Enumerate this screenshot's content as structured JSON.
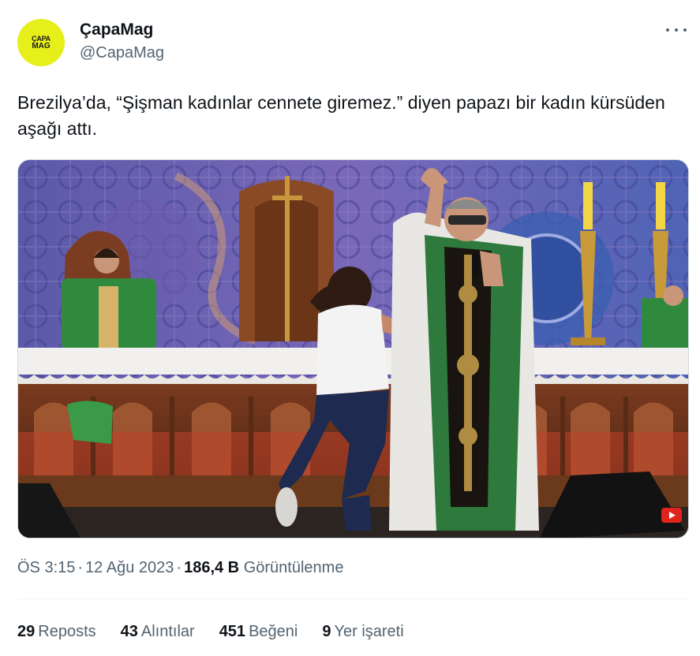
{
  "author": {
    "name": "ÇapaMag",
    "handle": "@CapaMag",
    "avatar_text_top": "ÇAPA",
    "avatar_text_bottom": "MAG",
    "avatar_color": "#e6ef1a"
  },
  "tweet": {
    "text": "Brezilya’da, “Şişman kadınlar cennete giremez.” diyen papazı bir kadın kürsüden aşağı attı."
  },
  "meta": {
    "time": "ÖS 3:15",
    "date": "12 Ağu 2023",
    "views_count": "186,4 B",
    "views_label": "Görüntülenme"
  },
  "stats": [
    {
      "count": "29",
      "label": "Reposts"
    },
    {
      "count": "43",
      "label": "Alıntılar"
    },
    {
      "count": "451",
      "label": "Beğeni"
    },
    {
      "count": "9",
      "label": "Yer işareti"
    }
  ],
  "icons": {
    "more": "more-horizontal-icon",
    "media_badge": "youtube-icon"
  }
}
